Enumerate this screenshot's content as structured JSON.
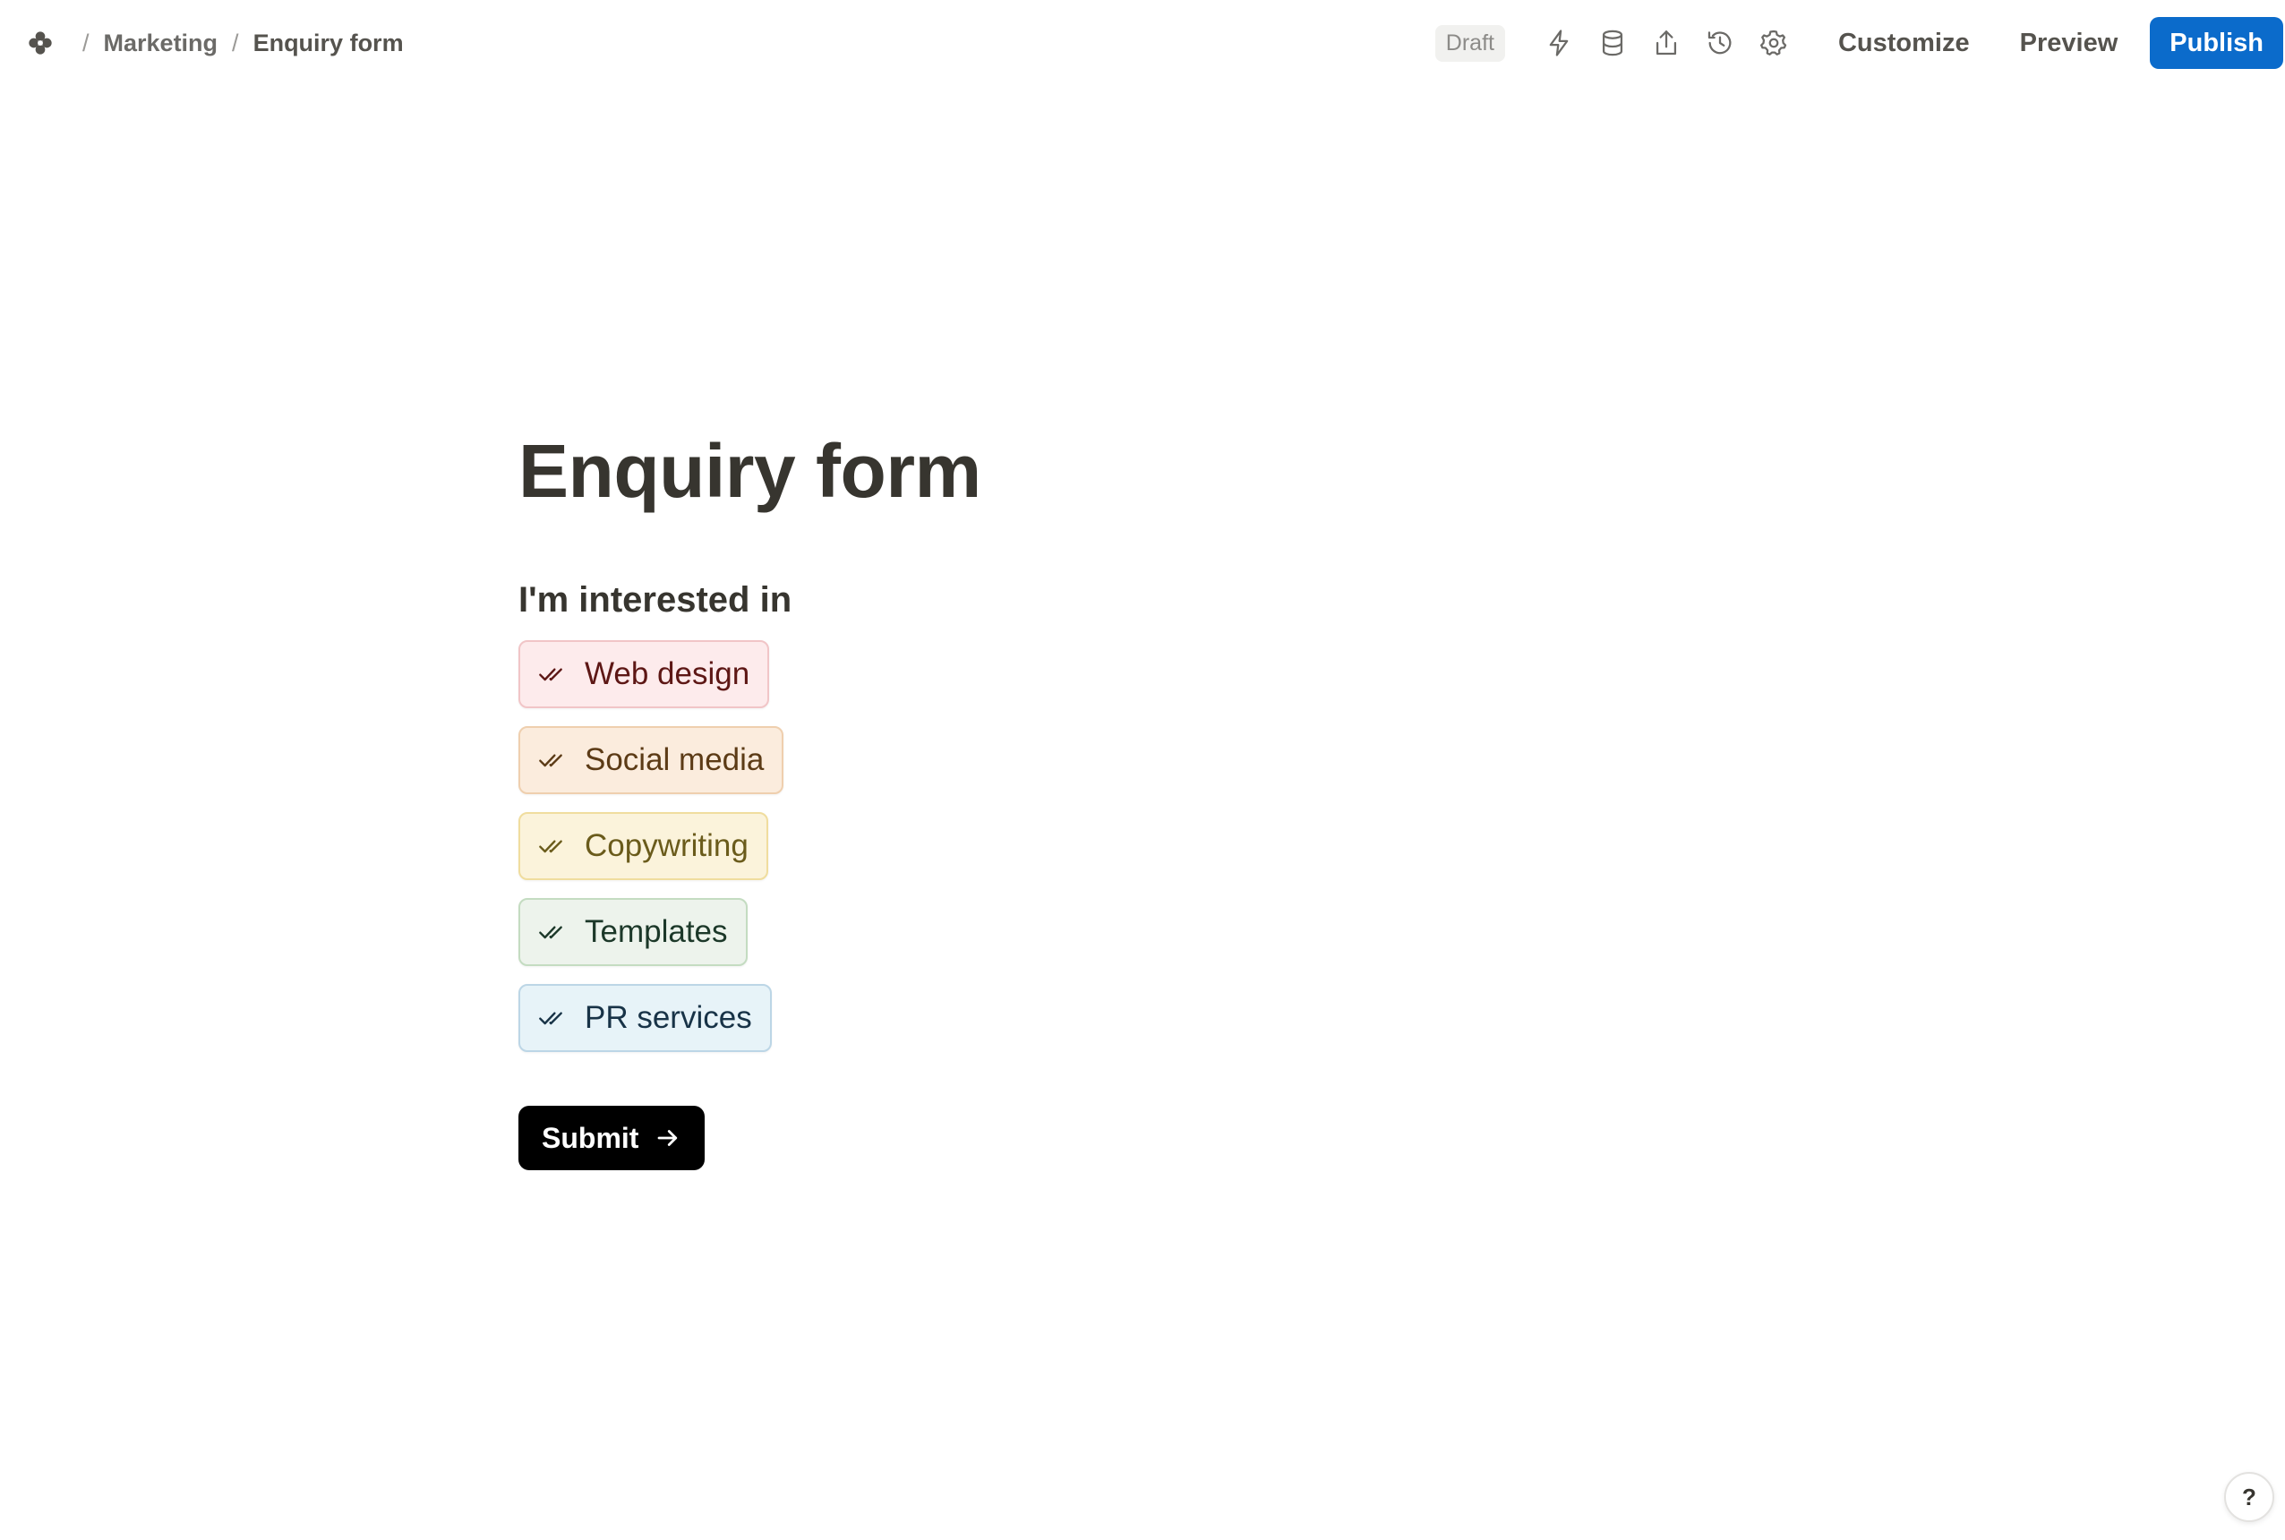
{
  "header": {
    "logo_icon": "flower-logo-icon",
    "breadcrumb": [
      {
        "label": "Marketing"
      },
      {
        "label": "Enquiry form"
      }
    ],
    "separator": "/",
    "status_badge": "Draft",
    "tool_icons": [
      "lightning-icon",
      "database-icon",
      "share-icon",
      "history-icon",
      "gear-icon"
    ],
    "customize_label": "Customize",
    "preview_label": "Preview",
    "publish_label": "Publish",
    "accent_color": "#0b6bcb"
  },
  "form": {
    "title": "Enquiry form",
    "question": "I'm interested in",
    "options": [
      {
        "label": "Web design",
        "bg": "#fdebec",
        "border": "#f1c5c7",
        "text": "#5d1715",
        "icon_color": "#5d1715"
      },
      {
        "label": "Social media",
        "bg": "#fbecdd",
        "border": "#efcfae",
        "text": "#5c3b16",
        "icon_color": "#5c3b16"
      },
      {
        "label": "Copywriting",
        "bg": "#fbf3db",
        "border": "#f0dd9e",
        "text": "#6a5b1b",
        "icon_color": "#6a5b1b"
      },
      {
        "label": "Templates",
        "bg": "#edf3ec",
        "border": "#c4dcc1",
        "text": "#1c3829",
        "icon_color": "#1c3829"
      },
      {
        "label": "PR services",
        "bg": "#e7f3f8",
        "border": "#bcd6e6",
        "text": "#183347",
        "icon_color": "#183347"
      }
    ],
    "submit_label": "Submit",
    "submit_icon": "arrow-right-icon"
  },
  "help": {
    "label": "?"
  }
}
